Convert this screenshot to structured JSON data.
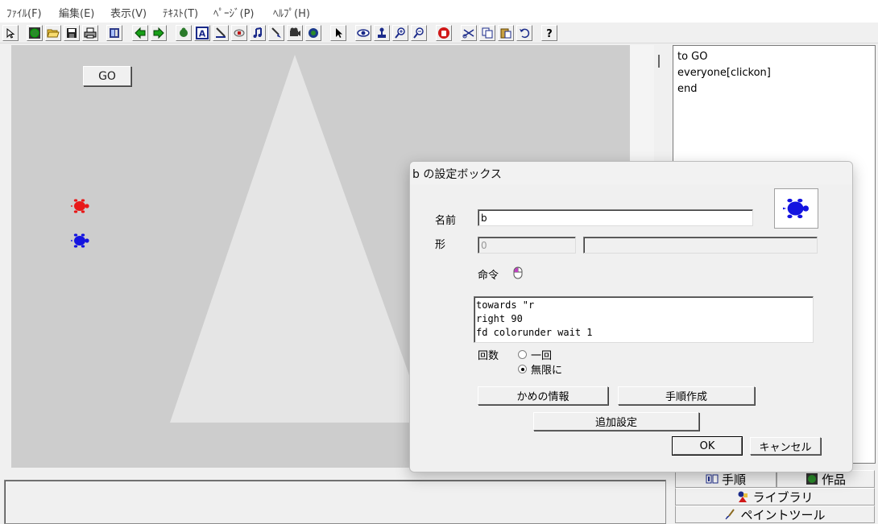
{
  "menubar": {
    "items": [
      "ﾌｧｲﾙ(F)",
      "編集(E)",
      "表示(V)",
      "ﾃｷｽﾄ(T)",
      "ﾍﾟｰｼﾞ(P)",
      "ﾍﾙﾌﾟ(H)"
    ]
  },
  "toolbar": {
    "icons": [
      "pointer-tool-icon",
      "globe-icon",
      "open-folder-icon",
      "save-disk-icon",
      "print-icon",
      "page-icon",
      "back-arrow-icon",
      "forward-arrow-icon",
      "hand-icon",
      "text-box-icon",
      "pen-icon",
      "slider-icon",
      "music-icon",
      "paint-brush-icon",
      "camera-icon",
      "turtle-icon",
      "arrow-cursor-icon",
      "eye-icon",
      "stamp-icon",
      "zoom-in-icon",
      "zoom-out-icon",
      "stop-hand-icon",
      "scissors-icon",
      "copy-icon",
      "paste-icon",
      "undo-icon",
      "help-icon"
    ]
  },
  "canvas": {
    "go_button_label": "GO",
    "turtles": [
      {
        "name": "turtle-red",
        "color": "#e81818"
      },
      {
        "name": "turtle-blue",
        "color": "#1414e0"
      }
    ],
    "triangle_color": "#e5e5e5",
    "background": "#cdcdcd"
  },
  "procedure_editor": {
    "lines": [
      "to GO",
      "everyone[clickon]",
      "end"
    ]
  },
  "bottom_tabs": {
    "procedures": "手順",
    "works": "作品",
    "library": "ライブラリ",
    "paint_tools": "ペイントツール"
  },
  "dialog": {
    "title": "b の設定ボックス",
    "name_label": "名前",
    "name_value": "b",
    "shape_label": "形",
    "shape_value": "0",
    "shape_extra_value": "",
    "command_label": "命令",
    "command_lines": [
      "towards \"r",
      "right 90",
      "fd colorunder wait 1"
    ],
    "repeat_label": "回数",
    "repeat_options": [
      {
        "label": "一回",
        "checked": false
      },
      {
        "label": "無限に",
        "checked": true
      }
    ],
    "turtle_info_button": "かめの情報",
    "make_procedure_button": "手順作成",
    "additional_settings_button": "追加設定",
    "ok_button": "OK",
    "cancel_button": "キャンセル",
    "shape_preview_color": "#1414e0"
  }
}
